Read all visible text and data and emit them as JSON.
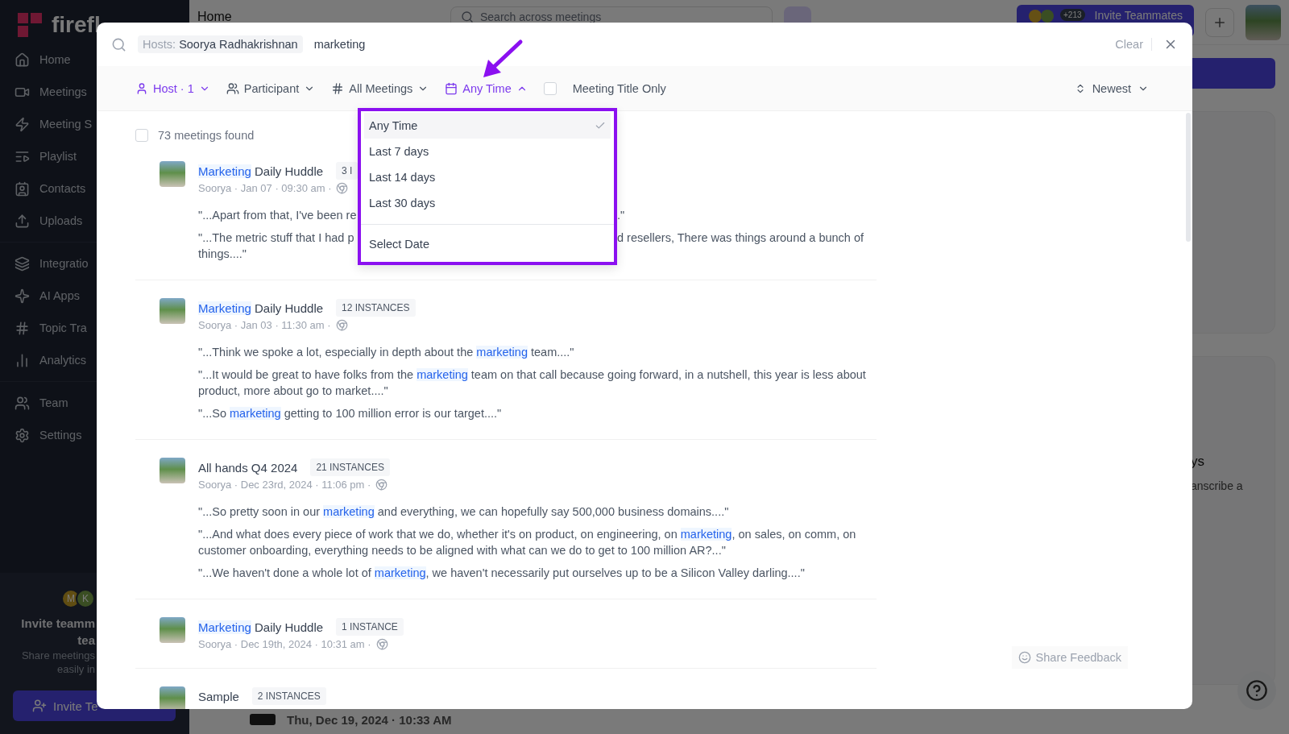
{
  "sidebar": {
    "logo": "firefl",
    "groups": [
      [
        {
          "label": "Home"
        },
        {
          "label": "Meetings"
        },
        {
          "label": "Meeting S"
        },
        {
          "label": "Playlist"
        },
        {
          "label": "Contacts"
        },
        {
          "label": "Uploads"
        }
      ],
      [
        {
          "label": "Integratio"
        },
        {
          "label": "AI Apps"
        },
        {
          "label": "Topic Tra"
        },
        {
          "label": "Analytics"
        }
      ],
      [
        {
          "label": "Team"
        },
        {
          "label": "Settings"
        }
      ]
    ],
    "invite_card": {
      "avatars": [
        {
          "initial": "M"
        },
        {
          "initial": "K"
        }
      ],
      "title_lines": [
        "Invite teamm",
        "tea"
      ],
      "text_lines": [
        "Share meetings",
        "easily in"
      ],
      "button": "Invite Te"
    }
  },
  "header": {
    "title": "Home",
    "search_placeholder": "Search across meetings",
    "avatar_count": "+213",
    "invite_button": "Invite Teammates"
  },
  "background": {
    "card_texts": [
      "ys",
      "anscribe a"
    ],
    "bottom_row": "Thu, Dec 19, 2024 · 10:33 AM"
  },
  "search_modal": {
    "host_chip": {
      "label": "Hosts:",
      "value": "Soorya Radhakrishnan"
    },
    "query": "marketing",
    "clear": "Clear",
    "filters": [
      {
        "label": "Host · 1",
        "active": true,
        "open": false
      },
      {
        "label": "Participant",
        "active": false,
        "open": false
      },
      {
        "label": "All Meetings",
        "active": false,
        "open": false
      },
      {
        "label": "Any Time",
        "active": true,
        "open": true
      }
    ],
    "title_only": {
      "label": "Meeting Title Only",
      "checked": false
    },
    "sort": "Newest",
    "time_menu": {
      "options": [
        {
          "label": "Any Time",
          "selected": true
        },
        {
          "label": "Last 7 days",
          "selected": false
        },
        {
          "label": "Last 14 days",
          "selected": false
        },
        {
          "label": "Last 30 days",
          "selected": false
        }
      ],
      "select_date": "Select Date"
    },
    "results_count": "73 meetings found",
    "select_all_checked": false,
    "results": [
      {
        "title": [
          {
            "text": "Marketing",
            "match": true
          },
          {
            "text": " Daily Huddle",
            "match": false
          }
        ],
        "badge": "3 I",
        "meta": "Soorya · Jan 07 · 09:30 am ·",
        "snippets": [
          {
            "kind": "split",
            "parts": [
              {
                "text": "\"...Apart from that, I've been re",
                "match": false
              }
            ],
            "after": [
              {
                "text": ".\"",
                "match": false
              }
            ]
          },
          {
            "kind": "split",
            "parts": [
              {
                "text": "\"...The metric stuff that I had p",
                "match": false
              }
            ],
            "after": [
              {
                "text": "d resellers, There was things around a bunch of",
                "match": false
              }
            ],
            "rest": [
              {
                "text": "things....\"",
                "match": false
              }
            ]
          }
        ]
      },
      {
        "title": [
          {
            "text": "Marketing",
            "match": true
          },
          {
            "text": " Daily Huddle",
            "match": false
          }
        ],
        "badge": "12 INSTANCES",
        "meta": "Soorya · Jan 03 · 11:30 am ·",
        "snippets": [
          {
            "kind": "text",
            "parts": [
              {
                "text": "\"...Think we spoke a lot, especially in depth about the ",
                "match": false
              },
              {
                "text": "marketing",
                "match": true
              },
              {
                "text": " team....\"",
                "match": false
              }
            ]
          },
          {
            "kind": "text",
            "parts": [
              {
                "text": "\"...It would be great to have folks from the ",
                "match": false
              },
              {
                "text": "marketing",
                "match": true
              },
              {
                "text": " team on that call because going forward, in a nutshell, this year is less about product, more about go to market....\"",
                "match": false
              }
            ]
          },
          {
            "kind": "text",
            "parts": [
              {
                "text": "\"...So ",
                "match": false
              },
              {
                "text": "marketing",
                "match": true
              },
              {
                "text": " getting to 100 million error is our target....\"",
                "match": false
              }
            ]
          }
        ]
      },
      {
        "title": [
          {
            "text": "All hands Q4 2024",
            "match": false
          }
        ],
        "badge": "21 INSTANCES",
        "meta": "Soorya · Dec 23rd, 2024 · 11:06 pm ·",
        "snippets": [
          {
            "kind": "text",
            "parts": [
              {
                "text": "\"...So pretty soon in our ",
                "match": false
              },
              {
                "text": "marketing",
                "match": true
              },
              {
                "text": " and everything, we can hopefully say 500,000 business domains....\"",
                "match": false
              }
            ]
          },
          {
            "kind": "text",
            "parts": [
              {
                "text": "\"...And what does every piece of work that we do, whether it's on product, on engineering, on ",
                "match": false
              },
              {
                "text": "marketing",
                "match": true
              },
              {
                "text": ", on sales, on comm, on customer onboarding, everything needs to be aligned with what can we do to get to 100 million AR?...\"",
                "match": false
              }
            ]
          },
          {
            "kind": "text",
            "parts": [
              {
                "text": "\"...We haven't done a whole lot of ",
                "match": false
              },
              {
                "text": "marketing",
                "match": true
              },
              {
                "text": ", we haven't necessarily put ourselves up to be a Silicon Valley darling....\"",
                "match": false
              }
            ]
          }
        ]
      },
      {
        "title": [
          {
            "text": "Marketing",
            "match": true
          },
          {
            "text": " Daily Huddle",
            "match": false
          }
        ],
        "badge": "1 INSTANCE",
        "meta": "Soorya · Dec 19th, 2024 · 10:31 am ·"
      },
      {
        "title": [
          {
            "text": "Sample",
            "match": false
          }
        ],
        "badge": "2 INSTANCES"
      }
    ],
    "feedback": "Share Feedback"
  }
}
